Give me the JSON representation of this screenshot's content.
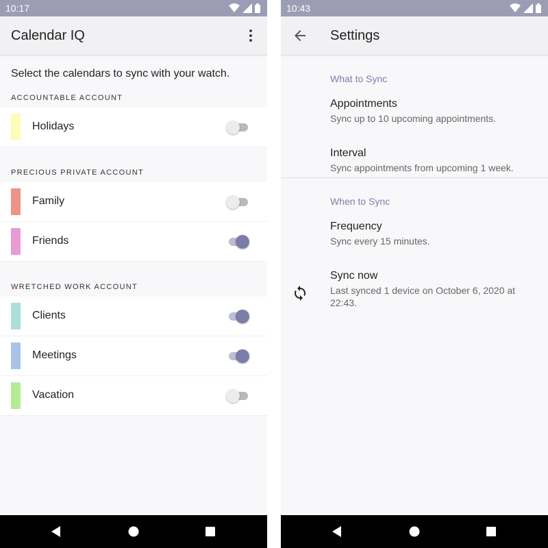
{
  "left": {
    "status_time": "10:17",
    "app_title": "Calendar IQ",
    "instruction": "Select the calendars to sync with your watch.",
    "accounts": [
      {
        "name": "ACCOUNTABLE ACCOUNT",
        "calendars": [
          {
            "label": "Holidays",
            "color": "#fdfcb8",
            "enabled": false
          }
        ]
      },
      {
        "name": "PRECIOUS PRIVATE ACCOUNT",
        "calendars": [
          {
            "label": "Family",
            "color": "#ee928a",
            "enabled": false
          },
          {
            "label": "Friends",
            "color": "#e89bd4",
            "enabled": true
          }
        ]
      },
      {
        "name": "WRETCHED WORK ACCOUNT",
        "calendars": [
          {
            "label": "Clients",
            "color": "#abe0d9",
            "enabled": true
          },
          {
            "label": "Meetings",
            "color": "#a9c3e6",
            "enabled": true
          },
          {
            "label": "Vacation",
            "color": "#b6eb96",
            "enabled": false
          }
        ]
      }
    ]
  },
  "right": {
    "status_time": "10:43",
    "app_title": "Settings",
    "what_to_sync": {
      "header": "What to Sync",
      "appointments_title": "Appointments",
      "appointments_summary": "Sync up to 10 upcoming appointments.",
      "interval_title": "Interval",
      "interval_summary": "Sync appointments from upcoming 1 week."
    },
    "when_to_sync": {
      "header": "When to Sync",
      "frequency_title": "Frequency",
      "frequency_summary": "Sync every 15 minutes.",
      "sync_now_title": "Sync now",
      "sync_now_summary": "Last synced 1 device on October 6, 2020 at 22:43."
    }
  },
  "colors": {
    "status_bar": "#9c9cb4",
    "accent": "#7c7ca8",
    "category_text": "#7d7da8"
  },
  "icons": {
    "status": [
      "wifi-icon",
      "cell-signal-icon",
      "battery-icon"
    ],
    "overflow": "more-vert-icon",
    "back": "arrow-back-icon",
    "sync": "sync-icon",
    "nav": [
      "back-triangle-icon",
      "home-circle-icon",
      "recents-square-icon"
    ]
  }
}
